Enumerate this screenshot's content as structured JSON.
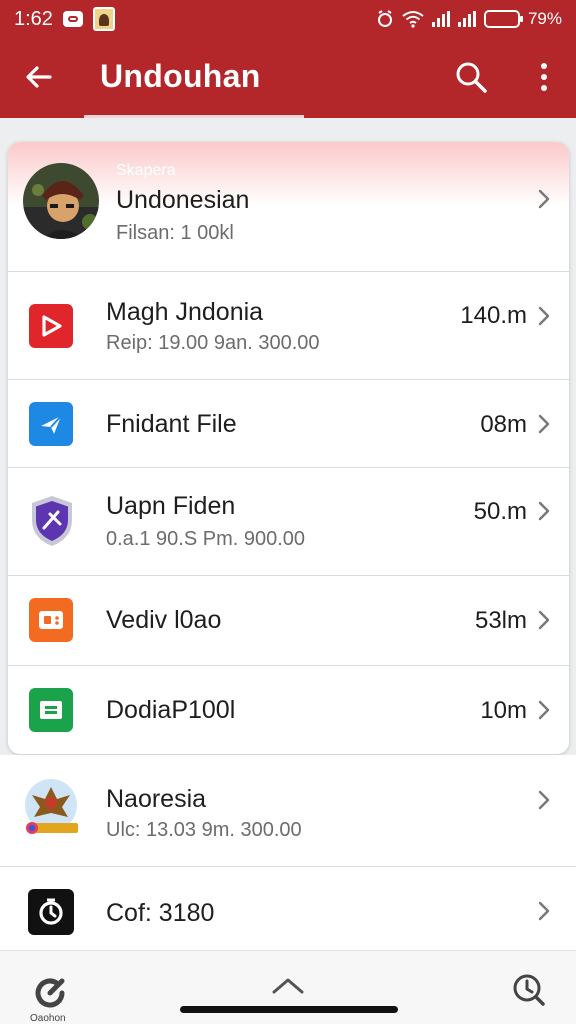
{
  "status_bar": {
    "time": "1:62",
    "battery_text": "79%",
    "battery_level": 0.79
  },
  "app_bar": {
    "title": "Undouhan",
    "back_icon": "arrow-left-icon",
    "search_icon": "search-icon",
    "more_icon": "more-vertical-icon"
  },
  "profile": {
    "small_label": "Skapera",
    "name": "Undonesian",
    "subtitle": "Filsan: 1 00kl"
  },
  "items": [
    {
      "name": "Magh Jndonia",
      "sub": "Reip: 19.00 9an. 300.00",
      "size": "140.m",
      "icon": "play-icon",
      "color": "#e0262b"
    },
    {
      "name": "Fnidant File",
      "sub": "",
      "size": "08m",
      "icon": "send-icon",
      "color": "#1e88e5"
    },
    {
      "name": "Uapn Fiden",
      "sub": "0.a.1 90.S Pm. 900.00",
      "size": "50.m",
      "icon": "shield-icon",
      "color": "#5e35b1"
    },
    {
      "name": "Vediv l0ao",
      "sub": "",
      "size": "53lm",
      "icon": "video-icon",
      "color": "#f26b21"
    },
    {
      "name": "DodiaP100l",
      "sub": "",
      "size": "10m",
      "icon": "document-icon",
      "color": "#1aa34a"
    }
  ],
  "outside_items": [
    {
      "name": "Naoresia",
      "sub": "Ulc: 13.03 9m. 300.00",
      "icon": "garuda-icon"
    },
    {
      "name": "Cof: 3180",
      "sub": "",
      "icon": "timer-icon"
    }
  ],
  "bottom_nav": {
    "left_label": "Oaohon",
    "left_icon": "refresh-icon",
    "center_icon": "chevron-up-icon",
    "right_icon": "clock-search-icon"
  }
}
